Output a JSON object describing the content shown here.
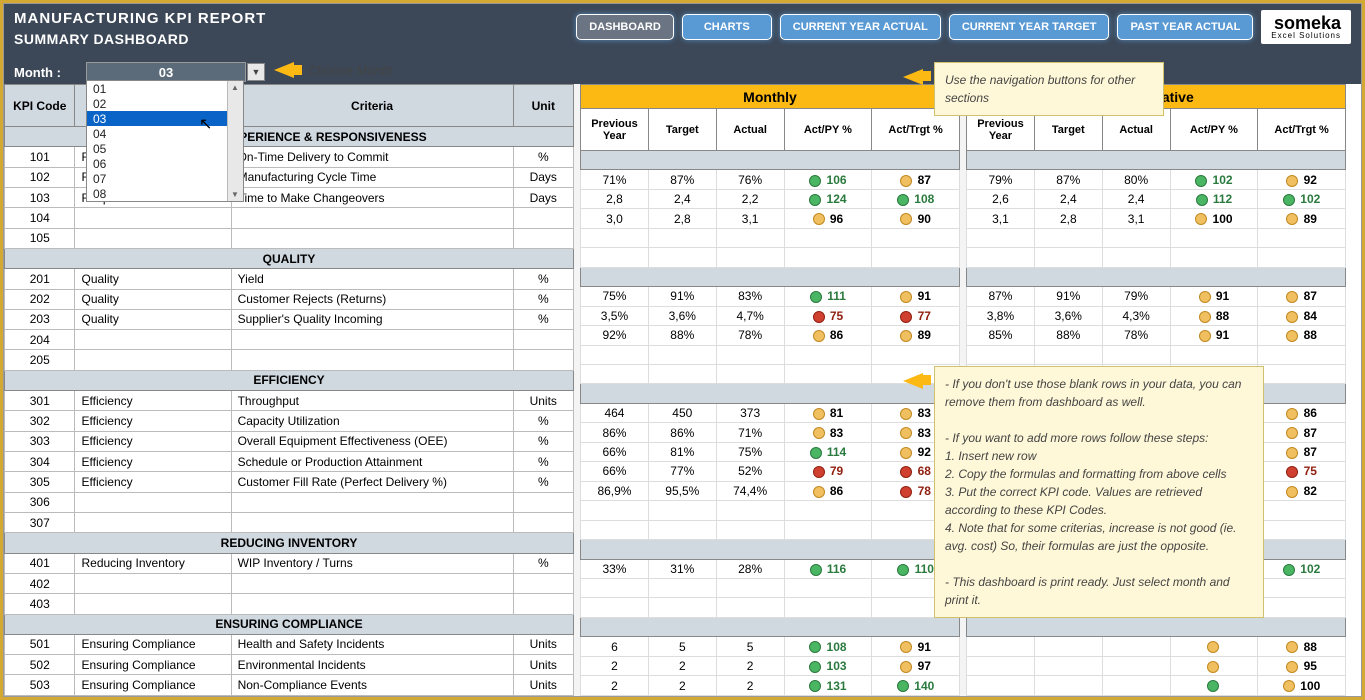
{
  "header": {
    "title": "MANUFACTURING KPI REPORT",
    "subtitle": "SUMMARY DASHBOARD"
  },
  "nav": {
    "dashboard": "DASHBOARD",
    "charts": "CHARTS",
    "cy_actual": "CURRENT YEAR ACTUAL",
    "cy_target": "CURRENT YEAR TARGET",
    "py_actual": "PAST YEAR ACTUAL"
  },
  "logo": {
    "name": "someka",
    "sub": "Excel Solutions"
  },
  "month": {
    "label": "Month :",
    "value": "03",
    "hint": "Choose Month",
    "options": [
      "01",
      "02",
      "03",
      "04",
      "05",
      "06",
      "07",
      "08"
    ]
  },
  "cols": {
    "kpi": "KPI Code",
    "criteria": "Criteria",
    "unit": "Unit",
    "py": "Previous Year",
    "target": "Target",
    "actual": "Actual",
    "actpy": "Act/PY %",
    "acttrg": "Act/Trgt %"
  },
  "groups": {
    "monthly": "Monthly",
    "cumulative": "Cumulative"
  },
  "sections": [
    {
      "name": "CUSTOMER EXPERIENCE & RESPONSIVENESS",
      "rows": [
        {
          "code": "101",
          "cat": "Responsiveness",
          "crit": "On-Time Delivery to Commit",
          "unit": "%",
          "m": [
            "71%",
            "87%",
            "76%",
            "106",
            "g",
            "87",
            "y"
          ],
          "c": [
            "79%",
            "87%",
            "80%",
            "102",
            "g",
            "92",
            "y"
          ]
        },
        {
          "code": "102",
          "cat": "Responsiveness",
          "crit": "Manufacturing Cycle Time",
          "unit": "Days",
          "m": [
            "2,8",
            "2,4",
            "2,2",
            "124",
            "g",
            "108",
            "g"
          ],
          "c": [
            "2,6",
            "2,4",
            "2,4",
            "112",
            "g",
            "102",
            "g"
          ]
        },
        {
          "code": "103",
          "cat": "Responsiveness",
          "crit": "Time to Make Changeovers",
          "unit": "Days",
          "m": [
            "3,0",
            "2,8",
            "3,1",
            "96",
            "y",
            "90",
            "y"
          ],
          "c": [
            "3,1",
            "2,8",
            "3,1",
            "100",
            "y",
            "89",
            "y"
          ]
        },
        {
          "code": "104"
        },
        {
          "code": "105"
        }
      ]
    },
    {
      "name": "QUALITY",
      "rows": [
        {
          "code": "201",
          "cat": "Quality",
          "crit": "Yield",
          "unit": "%",
          "m": [
            "75%",
            "91%",
            "83%",
            "111",
            "g",
            "91",
            "y"
          ],
          "c": [
            "87%",
            "91%",
            "79%",
            "91",
            "y",
            "87",
            "y"
          ]
        },
        {
          "code": "202",
          "cat": "Quality",
          "crit": "Customer Rejects (Returns)",
          "unit": "%",
          "m": [
            "3,5%",
            "3,6%",
            "4,7%",
            "75",
            "r",
            "77",
            "r"
          ],
          "c": [
            "3,8%",
            "3,6%",
            "4,3%",
            "88",
            "y",
            "84",
            "y"
          ]
        },
        {
          "code": "203",
          "cat": "Quality",
          "crit": "Supplier's Quality Incoming",
          "unit": "%",
          "m": [
            "92%",
            "88%",
            "78%",
            "86",
            "y",
            "89",
            "y"
          ],
          "c": [
            "85%",
            "88%",
            "78%",
            "91",
            "y",
            "88",
            "y"
          ]
        },
        {
          "code": "204"
        },
        {
          "code": "205"
        }
      ]
    },
    {
      "name": "EFFICIENCY",
      "rows": [
        {
          "code": "301",
          "cat": "Efficiency",
          "crit": "Throughput",
          "unit": "Units",
          "m": [
            "464",
            "450",
            "373",
            "81",
            "y",
            "83",
            "y"
          ],
          "c": [
            "",
            "",
            "",
            "",
            "y",
            "86",
            "y"
          ]
        },
        {
          "code": "302",
          "cat": "Efficiency",
          "crit": "Capacity Utilization",
          "unit": "%",
          "m": [
            "86%",
            "86%",
            "71%",
            "83",
            "y",
            "83",
            "y"
          ],
          "c": [
            "",
            "",
            "",
            "",
            "y",
            "87",
            "y"
          ]
        },
        {
          "code": "303",
          "cat": "Efficiency",
          "crit": "Overall Equipment Effectiveness (OEE)",
          "unit": "%",
          "m": [
            "66%",
            "81%",
            "75%",
            "114",
            "g",
            "92",
            "y"
          ],
          "c": [
            "",
            "",
            "",
            "",
            "y",
            "87",
            "y"
          ]
        },
        {
          "code": "304",
          "cat": "Efficiency",
          "crit": "Schedule or Production Attainment",
          "unit": "%",
          "m": [
            "66%",
            "77%",
            "52%",
            "79",
            "r",
            "68",
            "r"
          ],
          "c": [
            "",
            "",
            "",
            "",
            "r",
            "75",
            "r"
          ]
        },
        {
          "code": "305",
          "cat": "Efficiency",
          "crit": "Customer Fill Rate (Perfect Delivery %)",
          "unit": "%",
          "m": [
            "86,9%",
            "95,5%",
            "74,4%",
            "86",
            "y",
            "78",
            "r"
          ],
          "c": [
            "",
            "",
            "",
            "",
            "y",
            "82",
            "y"
          ]
        },
        {
          "code": "306"
        },
        {
          "code": "307"
        }
      ]
    },
    {
      "name": "REDUCING INVENTORY",
      "rows": [
        {
          "code": "401",
          "cat": "Reducing Inventory",
          "crit": "WIP Inventory / Turns",
          "unit": "%",
          "m": [
            "33%",
            "31%",
            "28%",
            "116",
            "g",
            "110",
            "g"
          ],
          "c": [
            "",
            "",
            "",
            "",
            "g",
            "102",
            "g"
          ]
        },
        {
          "code": "402"
        },
        {
          "code": "403"
        }
      ]
    },
    {
      "name": "ENSURING COMPLIANCE",
      "rows": [
        {
          "code": "501",
          "cat": "Ensuring Compliance",
          "crit": "Health and Safety Incidents",
          "unit": "Units",
          "m": [
            "6",
            "5",
            "5",
            "108",
            "g",
            "91",
            "y"
          ],
          "c": [
            "",
            "",
            "",
            "",
            "y",
            "88",
            "y"
          ]
        },
        {
          "code": "502",
          "cat": "Ensuring Compliance",
          "crit": "Environmental Incidents",
          "unit": "Units",
          "m": [
            "2",
            "2",
            "2",
            "103",
            "g",
            "97",
            "y"
          ],
          "c": [
            "",
            "",
            "",
            "",
            "y",
            "95",
            "y"
          ]
        },
        {
          "code": "503",
          "cat": "Ensuring Compliance",
          "crit": "Non-Compliance Events",
          "unit": "Units",
          "m": [
            "2",
            "2",
            "2",
            "131",
            "g",
            "140",
            "g"
          ],
          "c": [
            "",
            "",
            "",
            "",
            "g",
            "100",
            "y"
          ]
        }
      ]
    }
  ],
  "note1": "Use the navigation buttons for other sections",
  "note2": {
    "l1": "- If you don't use those blank rows in your data, you can remove them from dashboard as well.",
    "l2": "- If you want to add more rows follow these steps:",
    "l3": "1. Insert new row",
    "l4": "2. Copy the formulas and formatting from above cells",
    "l5": "3. Put the correct KPI code. Values are retrieved according to these KPI Codes.",
    "l6": "4. Note that for some criterias, increase is not good (ie. avg. cost) So, their formulas are just the opposite.",
    "l7": "- This dashboard is print ready. Just select month and print it."
  }
}
